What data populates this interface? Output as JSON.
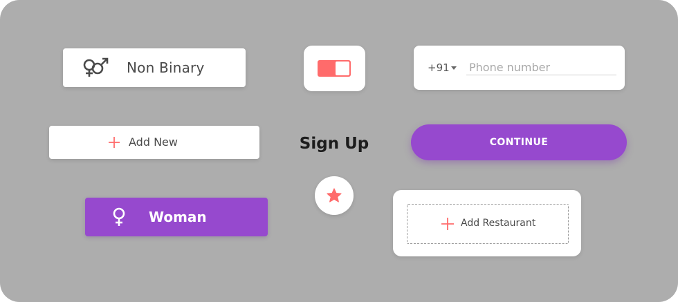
{
  "gender_chips": {
    "non_binary": {
      "label": "Non Binary",
      "icon": "non-binary-gender-icon"
    },
    "woman": {
      "label": "Woman",
      "icon": "female-gender-icon"
    }
  },
  "toggle": {
    "state": "on",
    "color": "#ff6b6b"
  },
  "phone_field": {
    "country_code": "+91",
    "placeholder": "Phone number",
    "value": ""
  },
  "buttons": {
    "add_new_label": "Add New",
    "continue_label": "CONTINUE",
    "add_restaurant_label": "Add Restaurant",
    "star_icon": "star-icon"
  },
  "heading": {
    "sign_up": "Sign Up"
  },
  "colors": {
    "background": "#adadad",
    "accent_purple": "#9649ce",
    "accent_red": "#ff6b6b",
    "card": "#ffffff"
  }
}
